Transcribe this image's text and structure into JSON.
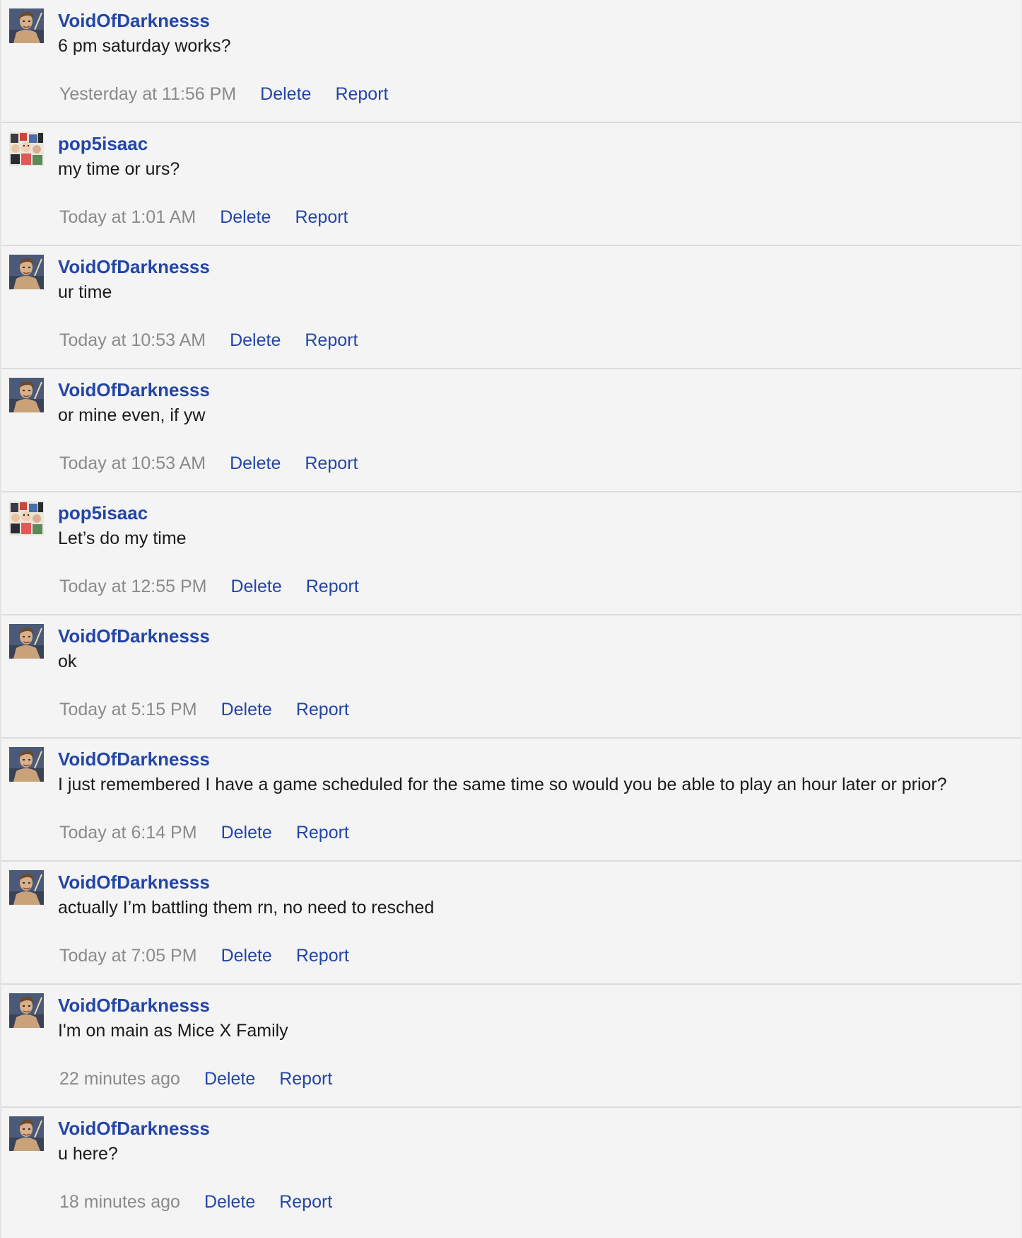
{
  "messages": [
    {
      "author": "VoidOfDarknesss",
      "avatar": "void",
      "text": "6 pm saturday works?",
      "time": "Yesterday at 11:56 PM",
      "delete_label": "Delete",
      "report_label": "Report"
    },
    {
      "author": "pop5isaac",
      "avatar": "pop",
      "text": "my time or urs?",
      "time": "Today at 1:01 AM",
      "delete_label": "Delete",
      "report_label": "Report"
    },
    {
      "author": "VoidOfDarknesss",
      "avatar": "void",
      "text": "ur time",
      "time": "Today at 10:53 AM",
      "delete_label": "Delete",
      "report_label": "Report"
    },
    {
      "author": "VoidOfDarknesss",
      "avatar": "void",
      "text": "or mine even, if yw",
      "time": "Today at 10:53 AM",
      "delete_label": "Delete",
      "report_label": "Report"
    },
    {
      "author": "pop5isaac",
      "avatar": "pop",
      "text": "Let’s do my time",
      "time": "Today at 12:55 PM",
      "delete_label": "Delete",
      "report_label": "Report"
    },
    {
      "author": "VoidOfDarknesss",
      "avatar": "void",
      "text": "ok",
      "time": "Today at 5:15 PM",
      "delete_label": "Delete",
      "report_label": "Report"
    },
    {
      "author": "VoidOfDarknesss",
      "avatar": "void",
      "text": "I just remembered I have a game scheduled for the same time so would you be able to play an hour later or prior?",
      "time": "Today at 6:14 PM",
      "delete_label": "Delete",
      "report_label": "Report"
    },
    {
      "author": "VoidOfDarknesss",
      "avatar": "void",
      "text": "actually I’m battling them rn, no need to resched",
      "time": "Today at 7:05 PM",
      "delete_label": "Delete",
      "report_label": "Report"
    },
    {
      "author": "VoidOfDarknesss",
      "avatar": "void",
      "text": "I'm on main as Mice X Family",
      "time": "22 minutes ago",
      "delete_label": "Delete",
      "report_label": "Report"
    },
    {
      "author": "VoidOfDarknesss",
      "avatar": "void",
      "text": "u here?",
      "time": "18 minutes ago",
      "delete_label": "Delete",
      "report_label": "Report"
    }
  ],
  "colors": {
    "link": "#2345a8",
    "timestamp": "#8a8a8a",
    "text": "#1a1a1a",
    "background": "#f4f4f4",
    "divider": "#dcdcdc"
  }
}
